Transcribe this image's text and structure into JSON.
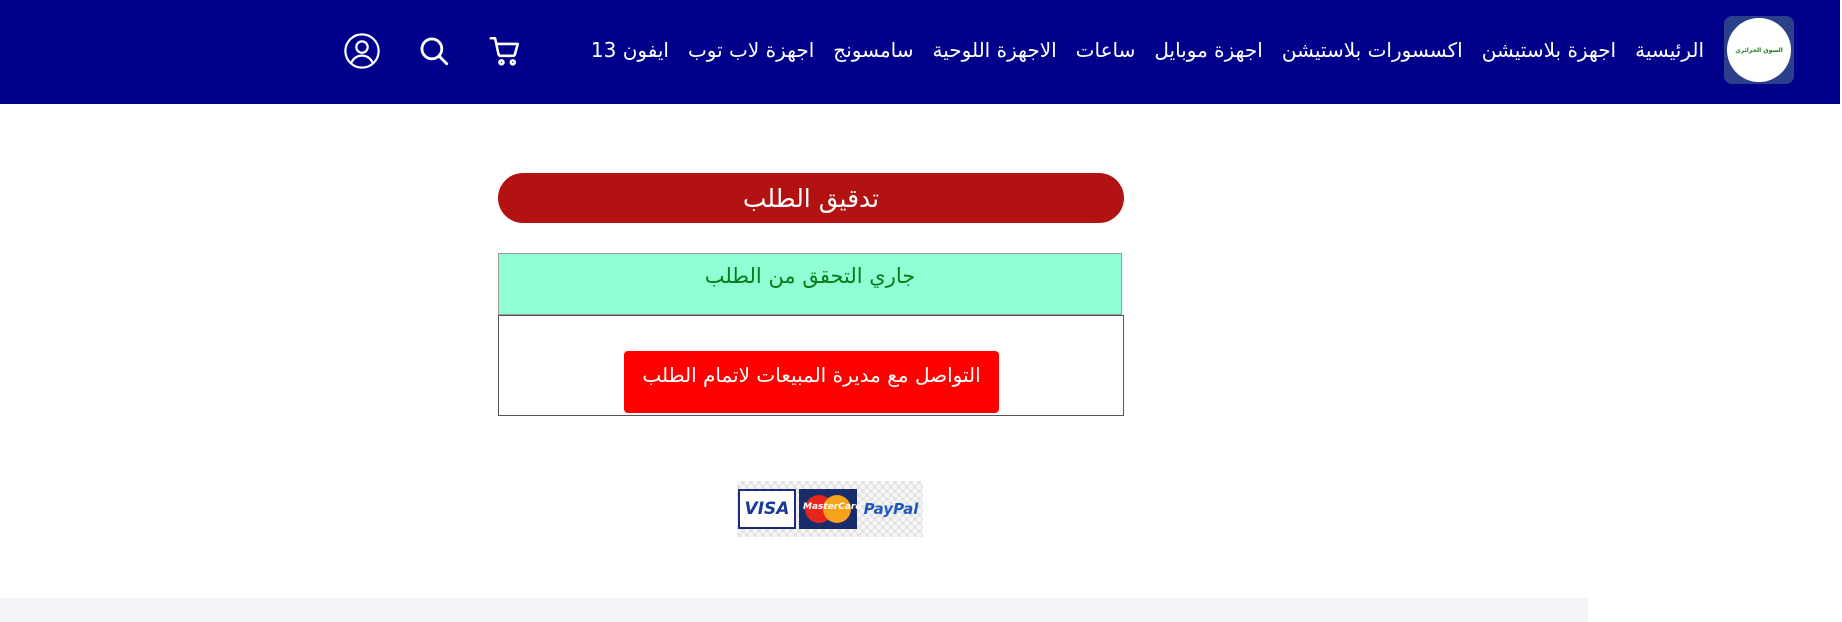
{
  "header": {
    "logo_text": "السوق الجزائري",
    "nav": [
      "الرئيسية",
      "اجهزة بلاستيشن",
      "اكسسورات بلاستيشن",
      "اجهزة موبايل",
      "ساعات",
      "الاجهزة اللوحية",
      "سامسونج",
      "اجهزة لاب توب",
      "ايفون 13"
    ],
    "icons": [
      "cart-icon",
      "search-icon",
      "account-icon"
    ]
  },
  "main": {
    "title": "تدقيق الطلب",
    "status": "جاري التحقق من الطلب",
    "contact_button": "التواصل مع مديرة المبيعات لاتمام الطلب"
  },
  "payment": {
    "visa": "VISA",
    "mastercard": "MasterCard",
    "paypal": "PayPal"
  },
  "colors": {
    "header_bg": "#00008b",
    "title_bg": "#b31212",
    "status_bg": "#90ffd4",
    "status_text": "#0a7a1a",
    "button_bg": "#ff0000"
  }
}
